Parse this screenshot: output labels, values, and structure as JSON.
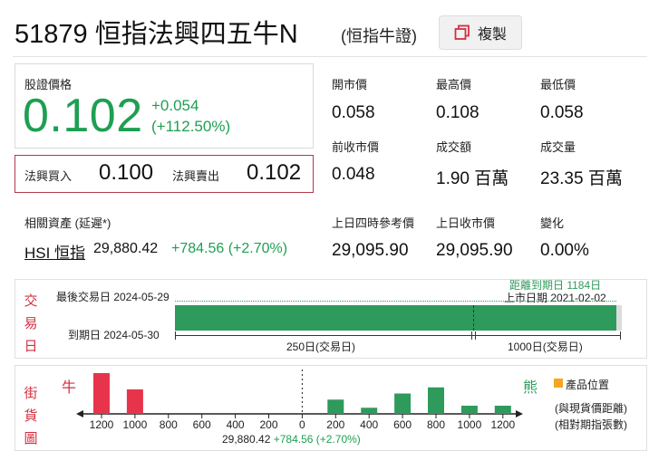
{
  "header": {
    "code_title": "51879 恒指法興四五牛N",
    "sub_title": "(恒指牛證)",
    "copy_label": "複製"
  },
  "price": {
    "label": "股證價格",
    "value": "0.102",
    "change": "+0.054",
    "change_pct": "(+112.50%)",
    "color": "#1e9f52"
  },
  "bid_ask": {
    "bid_label": "法興買入",
    "bid_value": "0.100",
    "ask_label": "法興賣出",
    "ask_value": "0.102"
  },
  "stats": [
    {
      "label": "開市價",
      "value": "0.058"
    },
    {
      "label": "最高價",
      "value": "0.108"
    },
    {
      "label": "最低價",
      "value": "0.058"
    },
    {
      "label": "前收市價",
      "value": "0.048"
    },
    {
      "label": "成交額",
      "value": "1.90 百萬"
    },
    {
      "label": "成交量",
      "value": "23.35 百萬"
    },
    {
      "label": "上日四時參考價",
      "value": "29,095.90"
    },
    {
      "label": "上日收市價",
      "value": "29,095.90"
    },
    {
      "label": "變化",
      "value": "0.00%"
    }
  ],
  "related": {
    "title": "相關資產 (延遲*)",
    "name": "HSI 恒指",
    "price": "29,880.42",
    "change": "+784.56 (+2.70%)"
  },
  "trade_days": {
    "side_label": [
      "交",
      "易",
      "日"
    ],
    "last_trade": "最後交易日 2024-05-29",
    "expiry": "到期日 2024-05-30",
    "days_to_expiry": "距離到期日 1184日",
    "listing_date": "上市日期 2021-02-02",
    "scale_250": "250日(交易日)",
    "scale_1000": "1000日(交易日)"
  },
  "street": {
    "side_label": [
      "街",
      "貨",
      "圖"
    ],
    "bull_label": "牛",
    "bear_label": "熊",
    "legend_label": "產品位置",
    "legend_note1": "(與現貨價距離)",
    "legend_note2": "(相對期指張數)",
    "ref_price": "29,880.42",
    "ref_change": "+784.56 (+2.70%)",
    "bull_color": "#e8344a",
    "bear_color": "#2e9a5c",
    "legend_color": "#f5a623"
  },
  "chart_data": {
    "type": "bar",
    "x_ticks": [
      "1200",
      "1000",
      "800",
      "600",
      "400",
      "200",
      "0",
      "200",
      "400",
      "600",
      "800",
      "1000",
      "1200"
    ],
    "series": [
      {
        "name": "牛",
        "categories": [
          "1200",
          "1000"
        ],
        "values": [
          10,
          6
        ]
      },
      {
        "name": "熊",
        "categories": [
          "200",
          "400",
          "600",
          "800",
          "1000",
          "1200"
        ],
        "values": [
          3.5,
          1.5,
          5,
          6.5,
          2,
          2
        ]
      }
    ]
  }
}
